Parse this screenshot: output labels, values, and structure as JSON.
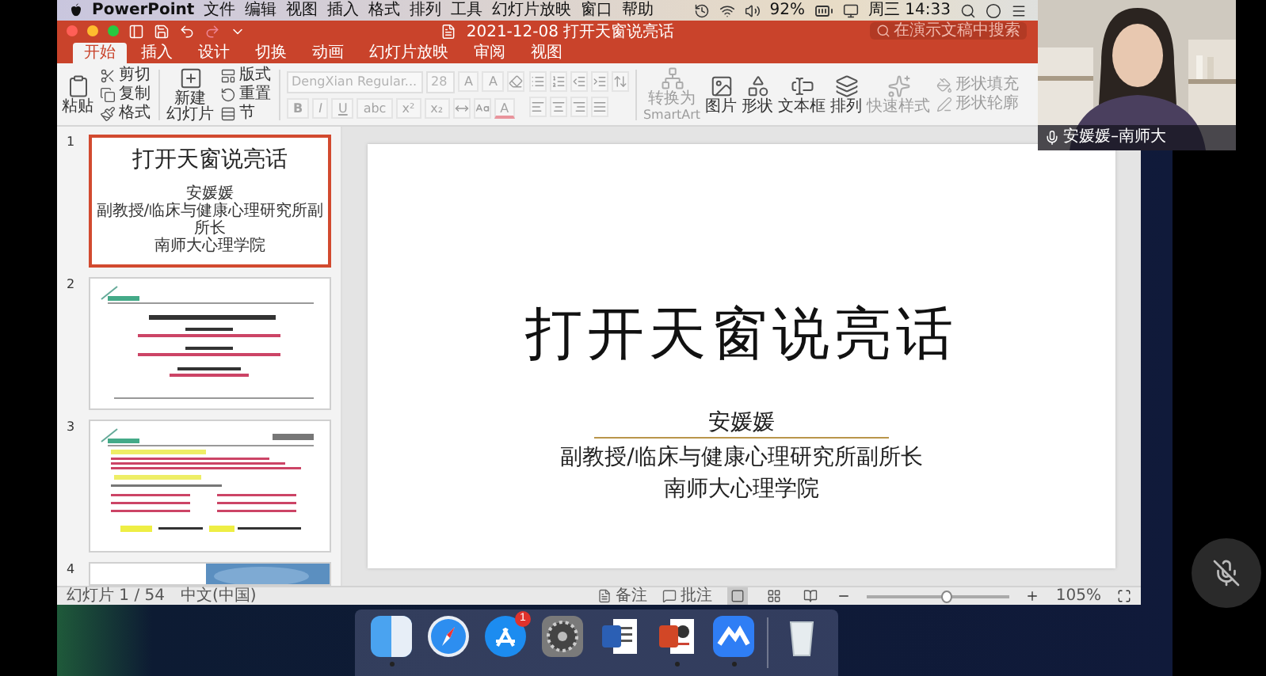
{
  "menu_bar": {
    "app": "PowerPoint",
    "menus": [
      "文件",
      "编辑",
      "视图",
      "插入",
      "格式",
      "排列",
      "工具",
      "幻灯片放映",
      "窗口",
      "帮助"
    ],
    "battery": "92%",
    "clock": "周三 14:33"
  },
  "window": {
    "title": "2021-12-08 打开天窗说亮话",
    "search": {
      "placeholder": "在演示文稿中搜索"
    }
  },
  "tabs": [
    {
      "label": "开始",
      "selected": true
    },
    {
      "label": "插入",
      "selected": false
    },
    {
      "label": "设计",
      "selected": false
    },
    {
      "label": "切换",
      "selected": false
    },
    {
      "label": "动画",
      "selected": false
    },
    {
      "label": "幻灯片放映",
      "selected": false
    },
    {
      "label": "审阅",
      "selected": false
    },
    {
      "label": "视图",
      "selected": false
    }
  ],
  "ribbon": [
    {
      "kind": "large",
      "lines": [
        "粘贴"
      ],
      "disabled": false
    },
    {
      "kind": "stack",
      "disabled": false,
      "items": [
        "剪切",
        "复制",
        "格式"
      ]
    },
    {
      "kind": "large",
      "lines": [
        "新建",
        "幻灯片"
      ],
      "disabled": false
    },
    {
      "kind": "stack",
      "disabled": false,
      "items": [
        "版式",
        "重置",
        "节"
      ]
    },
    {
      "kind": "font",
      "disabled": true,
      "font": "DengXian Regular...",
      "size": "28",
      "size_buttons": [
        "A",
        "A"
      ],
      "styles": [
        "B",
        "I",
        "U",
        "abc",
        "x²",
        "x₂"
      ],
      "color_button": "A"
    },
    {
      "kind": "paragraph",
      "disabled": true
    },
    {
      "kind": "large",
      "lines": [
        "转换为",
        "SmartArt"
      ],
      "disabled": true
    },
    {
      "kind": "large",
      "lines": [
        "图片"
      ],
      "disabled": false
    },
    {
      "kind": "large",
      "lines": [
        "形状"
      ],
      "disabled": false
    },
    {
      "kind": "large",
      "lines": [
        "文本框"
      ],
      "disabled": false
    },
    {
      "kind": "large",
      "lines": [
        "排列"
      ],
      "disabled": false
    },
    {
      "kind": "large",
      "lines": [
        "快速样式"
      ],
      "disabled": true
    },
    {
      "kind": "stack",
      "disabled": true,
      "items": [
        "形状填充",
        "形状轮廓"
      ]
    }
  ],
  "slides": [
    {
      "number": "1",
      "selected": true,
      "kind": "title",
      "title": "打开天窗说亮话",
      "presenter": "安媛媛",
      "position": "副教授/临床与健康心理研究所副所长",
      "affiliation": "南师大心理学院"
    },
    {
      "number": "2",
      "selected": false,
      "kind": "outline"
    },
    {
      "number": "3",
      "selected": false,
      "kind": "dense"
    },
    {
      "number": "4",
      "selected": false,
      "kind": "picture"
    }
  ],
  "current_slide": {
    "title": "打开天窗说亮话",
    "presenter": "安媛媛",
    "position": "副教授/临床与健康心理研究所副所长",
    "affiliation": "南师大心理学院"
  },
  "status_bar": {
    "slide_counter": "幻灯片 1 / 54",
    "language": "中文(中国)",
    "notes": "备注",
    "comments": "批注",
    "views": [
      {
        "kind": "normal",
        "selected": true
      },
      {
        "kind": "sorter",
        "selected": false
      },
      {
        "kind": "reading",
        "selected": false
      }
    ],
    "zoom": {
      "level": 0.55,
      "reading": "105%"
    }
  },
  "dock": [
    {
      "kind": "finder",
      "running": true
    },
    {
      "kind": "browser",
      "running": false
    },
    {
      "kind": "store",
      "running": false,
      "badge": "1"
    },
    {
      "kind": "settings",
      "running": false
    },
    {
      "kind": "word",
      "running": false
    },
    {
      "kind": "slides",
      "running": true
    },
    {
      "kind": "meeting",
      "running": true
    },
    {
      "kind": "trash",
      "running": false
    }
  ],
  "video": {
    "caption": "安媛媛–南师大"
  }
}
